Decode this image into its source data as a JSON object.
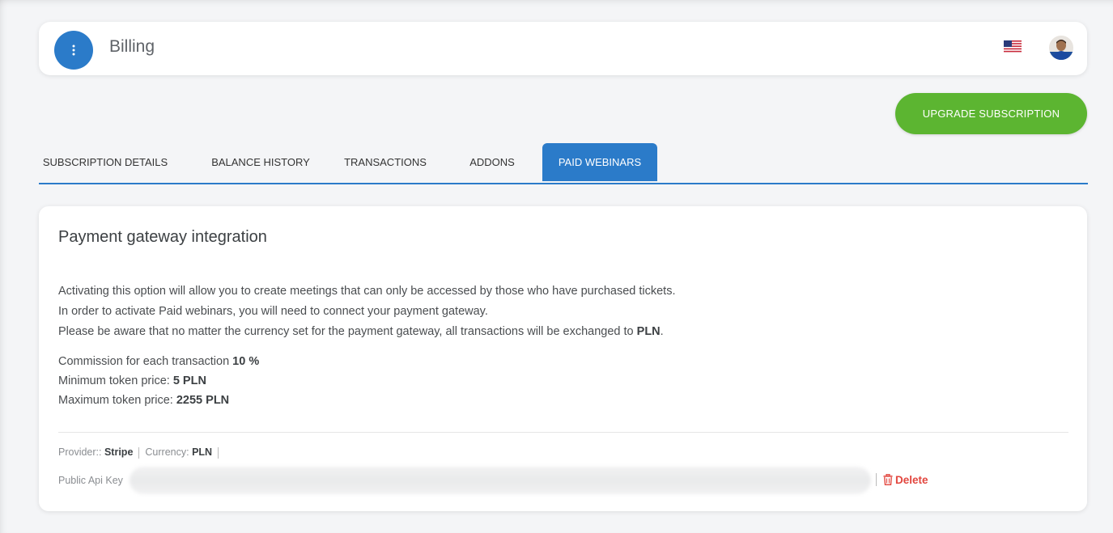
{
  "header": {
    "title": "Billing",
    "menu_icon": "vertical-dots-icon",
    "language_icon": "us-flag-icon",
    "avatar": "user-avatar"
  },
  "actions": {
    "upgrade_label": "UPGRADE SUBSCRIPTION"
  },
  "tabs": [
    {
      "label": "SUBSCRIPTION DETAILS",
      "active": false
    },
    {
      "label": "BALANCE HISTORY",
      "active": false
    },
    {
      "label": "TRANSACTIONS",
      "active": false
    },
    {
      "label": "ADDONS",
      "active": false
    },
    {
      "label": "PAID WEBINARS",
      "active": true
    }
  ],
  "card": {
    "title": "Payment gateway integration",
    "line1": "Activating this option will allow you to create meetings that can only be accessed by those who have purchased tickets.",
    "line2": "In order to activate Paid webinars, you will need to connect your payment gateway.",
    "line3_prefix": "Please be aware that no matter the currency set for the payment gateway, all transactions will be exchanged to ",
    "line3_currency": "PLN",
    "line3_suffix": ".",
    "commission_label": "Commission for each transaction ",
    "commission_value": "10 %",
    "min_label": "Minimum token price: ",
    "min_value": "5 PLN",
    "max_label": "Maximum token price: ",
    "max_value": "2255 PLN",
    "provider_label": "Provider:: ",
    "provider_value": "Stripe",
    "currency_label": "Currency: ",
    "currency_value": "PLN",
    "api_key_label": "Public Api Key",
    "delete_label": "Delete",
    "delete_icon": "trash-icon"
  },
  "colors": {
    "primary": "#2b7bc9",
    "success": "#5cb531",
    "danger": "#e2463e"
  }
}
